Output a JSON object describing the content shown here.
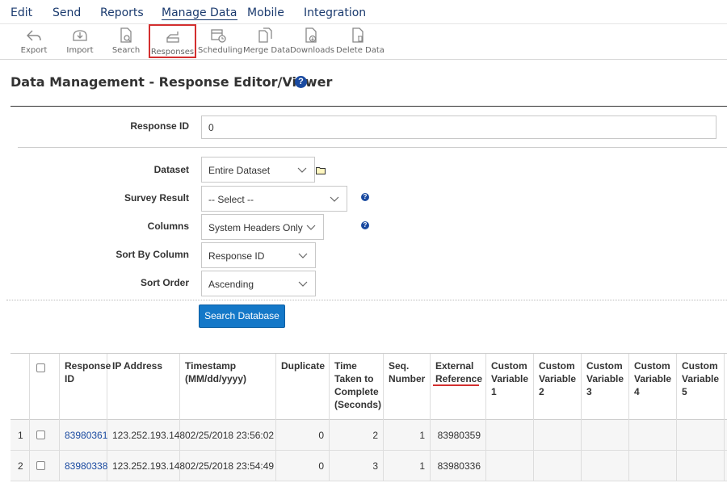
{
  "menu": {
    "items": [
      {
        "label": "Edit"
      },
      {
        "label": "Send"
      },
      {
        "label": "Reports"
      },
      {
        "label": "Manage Data"
      },
      {
        "label": "Mobile"
      },
      {
        "label": "Integration"
      }
    ],
    "active": "Manage Data"
  },
  "toolbar": {
    "items": [
      {
        "label": "Export",
        "icon": "export-icon"
      },
      {
        "label": "Import",
        "icon": "import-icon"
      },
      {
        "label": "Search",
        "icon": "search-document-icon"
      },
      {
        "label": "Responses",
        "icon": "responses-icon"
      },
      {
        "label": "Scheduling",
        "icon": "scheduling-icon"
      },
      {
        "label": "Merge Data",
        "icon": "merge-data-icon"
      },
      {
        "label": "Downloads",
        "icon": "downloads-icon"
      },
      {
        "label": "Delete Data",
        "icon": "delete-data-icon"
      }
    ],
    "selected": "Responses"
  },
  "page": {
    "title": "Data Management - Response Editor/Viewer",
    "help": "?"
  },
  "form": {
    "response_id": {
      "label": "Response ID",
      "value": "0"
    },
    "dataset": {
      "label": "Dataset",
      "value": "Entire Dataset"
    },
    "survey_result": {
      "label": "Survey Result",
      "value": "-- Select --"
    },
    "columns": {
      "label": "Columns",
      "value": "System Headers Only"
    },
    "sort_by": {
      "label": "Sort By Column",
      "value": "Response ID"
    },
    "sort_order": {
      "label": "Sort Order",
      "value": "Ascending"
    },
    "search_button": "Search Database",
    "help": "?"
  },
  "table": {
    "headers": [
      "Response ID",
      "IP Address",
      "Timestamp (MM/dd/yyyy)",
      "Duplicate",
      "Time Taken to Complete (Seconds)",
      "Seq. Number",
      "External Reference",
      "Custom Variable 1",
      "Custom Variable 2",
      "Custom Variable 3",
      "Custom Variable 4",
      "Custom Variable 5"
    ],
    "rows": [
      {
        "num": "1",
        "response_id": "83980361",
        "ip": "123.252.193.148",
        "timestamp": "02/25/2018 23:56:02",
        "duplicate": "0",
        "time_taken": "2",
        "seq": "1",
        "ext_ref": "83980359"
      },
      {
        "num": "2",
        "response_id": "83980338",
        "ip": "123.252.193.148",
        "timestamp": "02/25/2018 23:54:49",
        "duplicate": "0",
        "time_taken": "3",
        "seq": "1",
        "ext_ref": "83980336"
      }
    ]
  },
  "colors": {
    "link": "#1a4aa0",
    "button": "#1478c8",
    "highlight": "#d32f2f"
  }
}
